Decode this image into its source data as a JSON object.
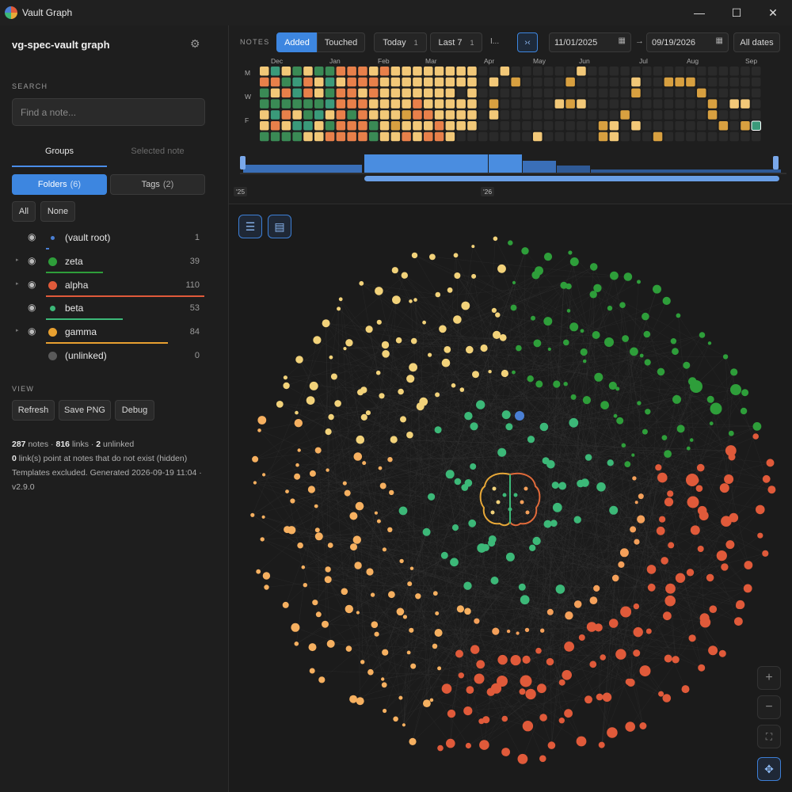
{
  "window": {
    "title": "Vault Graph",
    "minimize_icon": "minimize-icon",
    "maximize_icon": "maximize-icon",
    "close_icon": "close-icon"
  },
  "sidebar": {
    "vault_name": "vg-spec-vault graph",
    "search_label": "SEARCH",
    "search_placeholder": "Find a note...",
    "tabs": {
      "groups": "Groups",
      "selected": "Selected note"
    },
    "group_mode": {
      "folders_label": "Folders",
      "folders_count": "(6)",
      "tags_label": "Tags",
      "tags_count": "(2)"
    },
    "select": {
      "all": "All",
      "none": "None"
    },
    "folders": [
      {
        "name": "(vault root)",
        "count": "1",
        "color": "#4a7fd4",
        "has_children": false,
        "visible": true
      },
      {
        "name": "zeta",
        "count": "39",
        "color": "#2e9e3a",
        "has_children": true,
        "visible": true
      },
      {
        "name": "alpha",
        "count": "110",
        "color": "#e05a3a",
        "has_children": true,
        "visible": true
      },
      {
        "name": "beta",
        "count": "53",
        "color": "#3cb878",
        "has_children": false,
        "visible": true
      },
      {
        "name": "gamma",
        "count": "84",
        "color": "#e8a030",
        "has_children": true,
        "visible": true
      },
      {
        "name": "(unlinked)",
        "count": "0",
        "color": "#5a5a5a",
        "has_children": false,
        "visible": false
      }
    ],
    "view_label": "VIEW",
    "view_buttons": {
      "refresh": "Refresh",
      "save_png": "Save PNG",
      "debug": "Debug"
    },
    "stats": {
      "notes": "287",
      "notes_label": "notes ·",
      "links": "816",
      "links_label": "links ·",
      "unlinked": "2",
      "unlinked_label": "unlinked",
      "missing": "0",
      "missing_label": "link(s) point at notes that do not exist (hidden)",
      "footer": "Templates excluded. Generated 2026-09-19 11:04 · v2.9.0"
    }
  },
  "timeline": {
    "label": "NOTES",
    "modes": {
      "added": "Added",
      "touched": "Touched"
    },
    "active_mode": "Added",
    "quick": {
      "today": "Today",
      "today_key": "1",
      "last7": "Last 7",
      "last7_key": "1",
      "more": "I..."
    },
    "date_from": "11/01/2025",
    "date_to": "09/19/2026",
    "all_dates": "All dates",
    "months": [
      "Dec",
      "Jan",
      "Feb",
      "Mar",
      "Apr",
      "May",
      "Jun",
      "Jul",
      "Aug",
      "Sep"
    ],
    "days": [
      "M",
      "W",
      "F"
    ],
    "years": [
      "'25",
      "'26"
    ],
    "colors": {
      "green": "#3a8a55",
      "teal": "#3a9a7a",
      "orange": "#e8804a",
      "light": "#f2c878",
      "amber": "#d8a040",
      "empty": "#2a2a2a"
    }
  },
  "graph": {
    "center_icon": "brain-icon",
    "toolbar": {
      "list_icon": "list-icon",
      "window_icon": "window-icon"
    },
    "zoom": {
      "in": "+",
      "out": "−",
      "fit_icon": "fit-icon",
      "pan_icon": "move-icon"
    }
  }
}
